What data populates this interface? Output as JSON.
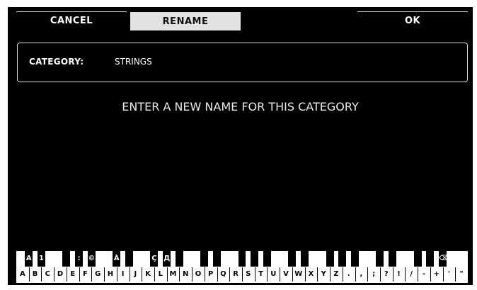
{
  "buttons": {
    "cancel": "CANCEL",
    "rename": "RENAME",
    "ok": "OK"
  },
  "category": {
    "label": "CATEGORY:",
    "value": "STRINGS"
  },
  "prompt": "ENTER A NEW NAME FOR THIS CATEGORY",
  "keyboard": {
    "white_keys": [
      "A",
      "B",
      "C",
      "D",
      "E",
      "F",
      "G",
      "H",
      "I",
      "J",
      "K",
      "L",
      "M",
      "N",
      "O",
      "P",
      "Q",
      "R",
      "S",
      "T",
      "U",
      "V",
      "W",
      "X",
      "Y",
      "Z",
      ".",
      ",",
      ";",
      "?",
      "!",
      "/",
      "-",
      "+",
      "'",
      "\""
    ],
    "black_keys": [
      "A",
      "1",
      "",
      ":",
      "©",
      "À",
      "",
      "Ç",
      "Д",
      "",
      "",
      "",
      "",
      "",
      "",
      "",
      "",
      "",
      "",
      "",
      "",
      "",
      "",
      "",
      "⌫",
      "",
      "«",
      "»",
      "",
      "◀",
      "▶",
      "␣"
    ]
  }
}
